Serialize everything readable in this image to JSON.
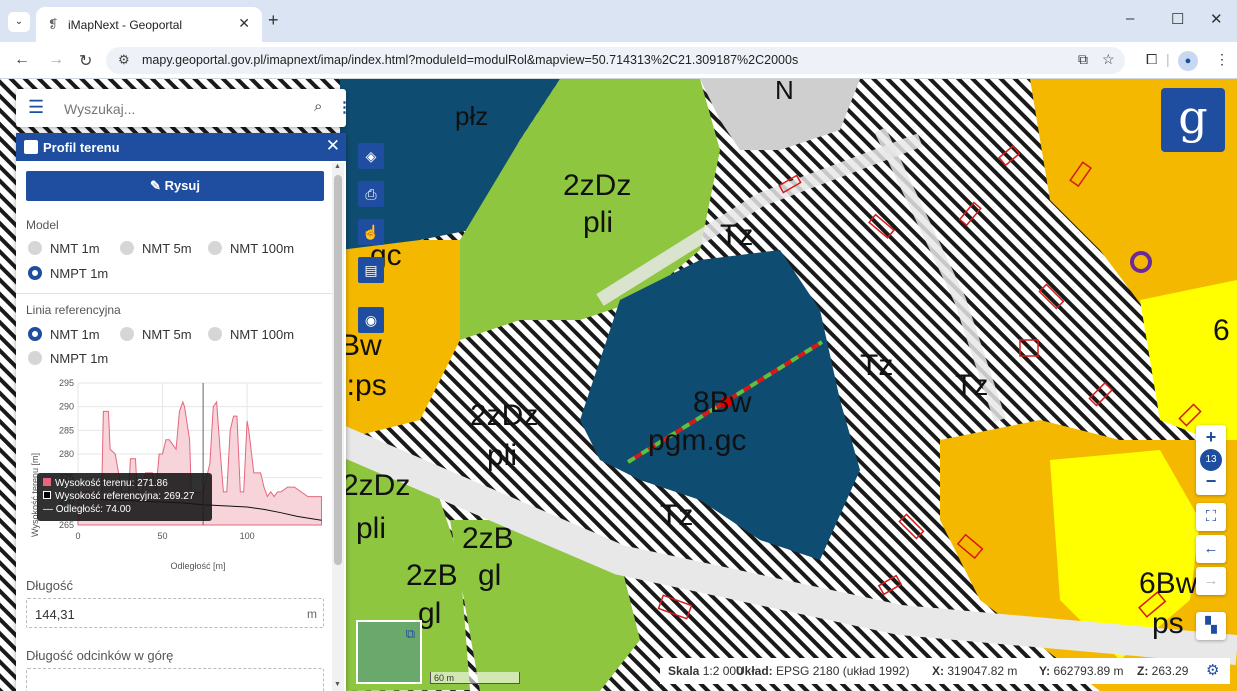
{
  "browser": {
    "tab_title": "iMapNext - Geoportal",
    "url": "mapy.geoportal.gov.pl/imapnext/imap/index.html?moduleId=modulRol&mapview=50.714313%2C21.309187%2C2000s"
  },
  "search": {
    "placeholder": "Wyszukaj..."
  },
  "panel": {
    "title": "Profil terenu",
    "draw_button": "Rysuj",
    "model_label": "Model",
    "model_options": [
      "NMT 1m",
      "NMT 5m",
      "NMT 100m",
      "NMPT 1m"
    ],
    "model_selected": "NMPT 1m",
    "ref_label": "Linia referencyjna",
    "ref_options": [
      "NMT 1m",
      "NMT 5m",
      "NMT 100m",
      "NMPT 1m"
    ],
    "ref_selected": "NMT 1m",
    "length_label": "Długość",
    "length_value": "144,31",
    "length_unit": "m",
    "uphill_label": "Długość odcinków w górę"
  },
  "chart_data": {
    "type": "area",
    "ylabel": "Wysokość terenu [m]",
    "xlabel": "Odległość [m]",
    "xlim": [
      0,
      144.31
    ],
    "ylim": [
      265,
      295
    ],
    "x_ticks": [
      0,
      50,
      100
    ],
    "y_ticks": [
      265,
      270,
      275,
      280,
      285,
      290,
      295
    ],
    "series": [
      {
        "name": "Wysokość terenu",
        "color": "#e5677d",
        "x": [
          0,
          8,
          14,
          15,
          18,
          19,
          22,
          26,
          30,
          31,
          34,
          35,
          38,
          40,
          44,
          46,
          48,
          50,
          52,
          54,
          58,
          60,
          62,
          63,
          66,
          67,
          72,
          74,
          78,
          80,
          82,
          84,
          86,
          88,
          90,
          92,
          94,
          96,
          98,
          100,
          101,
          104,
          108,
          110,
          112,
          114,
          116,
          118,
          120,
          124,
          128,
          132,
          136,
          140,
          144
        ],
        "y": [
          272,
          272,
          272,
          289,
          289,
          281,
          280,
          272,
          272,
          279,
          279,
          272,
          272,
          276,
          276,
          272,
          280,
          280,
          283,
          283,
          281,
          289,
          291,
          290,
          283,
          272,
          271.86,
          272,
          278,
          290,
          291,
          281,
          272,
          272,
          285,
          288,
          288,
          272,
          272,
          287,
          285,
          276,
          276,
          273,
          271,
          272,
          271,
          272,
          272,
          273,
          273,
          272,
          271,
          271,
          271
        ]
      },
      {
        "name": "Wysokość referencyjna",
        "color": "#111111",
        "x": [
          0,
          20,
          40,
          60,
          74,
          90,
          100,
          110,
          120,
          130,
          144
        ],
        "y": [
          270.5,
          270.3,
          270,
          269.7,
          269.27,
          269,
          268.8,
          268.3,
          267.6,
          266.8,
          266
        ]
      }
    ],
    "cursor_x": 74,
    "tooltip": {
      "terrain": "Wysokość terenu: 271.86",
      "reference": "Wysokość referencyjna: 269.27",
      "distance": "— Odległość: 74.00"
    }
  },
  "map": {
    "labels": [
      "płz",
      "2zDz",
      "pli",
      "8Bw",
      "pgm.gc",
      "Tz",
      "2zDz",
      "pli",
      "2zDz",
      "pli",
      "2zB",
      "gl",
      "2zB",
      "gl",
      "6Bw",
      "ps",
      "6",
      "Bw",
      "n:ps",
      "gc",
      "Tz",
      "N"
    ],
    "logo_glyph": "g",
    "zoom_level": "13",
    "scale_text": "60 m"
  },
  "status": {
    "scale_label": "Skala",
    "scale_value": "1:2 000",
    "crs_label": "Układ:",
    "crs_value": "EPSG 2180 (układ 1992)",
    "x_label": "X:",
    "x_value": "319047.82 m",
    "y_label": "Y:",
    "y_value": "662793.89 m",
    "z_label": "Z:",
    "z_value": "263.29"
  },
  "colors": {
    "water": "#0f4c71",
    "green": "#8ec63f",
    "orange": "#f5b800",
    "yellow": "#ffff00",
    "accent": "#1f4ea0"
  }
}
